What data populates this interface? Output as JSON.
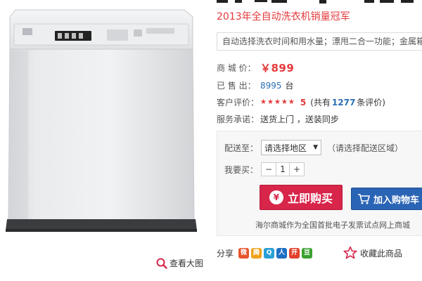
{
  "product": {
    "subtitle": "2013年全自动洗衣机销量冠军",
    "features": "自动选择洗衣时间和用水量；漂甩二合一功能；金属箱"
  },
  "info": {
    "price_label": "商 城 价：",
    "price": "￥899",
    "sold_label": "已 售 出：",
    "sold_count": "8995",
    "sold_unit": "台",
    "rating_label": "客户评价：",
    "rating_stars": 5,
    "rating_score": "5",
    "rating_prefix": "(共有",
    "rating_count": "1277",
    "rating_suffix": "条评价)",
    "service_label": "服务承诺：",
    "service_text": "送货上门 ，送装同步"
  },
  "purchase": {
    "region_label": "配送至：",
    "region_value": "请选择地区",
    "region_hint": "（请选择配送区域）",
    "qty_label": "我要买：",
    "qty_minus": "−",
    "qty_value": "1",
    "qty_plus": "+",
    "buy_icon": "¥",
    "buy_label": "立即购买",
    "cart_label": "加入购物车",
    "footnote": "海尔商城作为全国首批电子发票试点网上商城"
  },
  "gallery": {
    "view_large": "查看大图"
  },
  "share": {
    "label": "分享",
    "icons": [
      {
        "name": "weibo-icon",
        "glyph": "微",
        "color": "#e8552e"
      },
      {
        "name": "tencent-weibo-icon",
        "glyph": "腾",
        "color": "#f0a21a"
      },
      {
        "name": "qzone-icon",
        "glyph": "Q",
        "color": "#2a9fd6"
      },
      {
        "name": "renren-icon",
        "glyph": "人",
        "color": "#1e6fc2"
      },
      {
        "name": "kaixin-icon",
        "glyph": "开",
        "color": "#e2402e"
      },
      {
        "name": "douban-icon",
        "glyph": "豆",
        "color": "#3aa12f"
      }
    ]
  },
  "favorite": {
    "label": "收藏此商品"
  },
  "colors": {
    "accent_red": "#e4393c",
    "buy_button": "#d8254a",
    "cart_button": "#2a64b5"
  }
}
